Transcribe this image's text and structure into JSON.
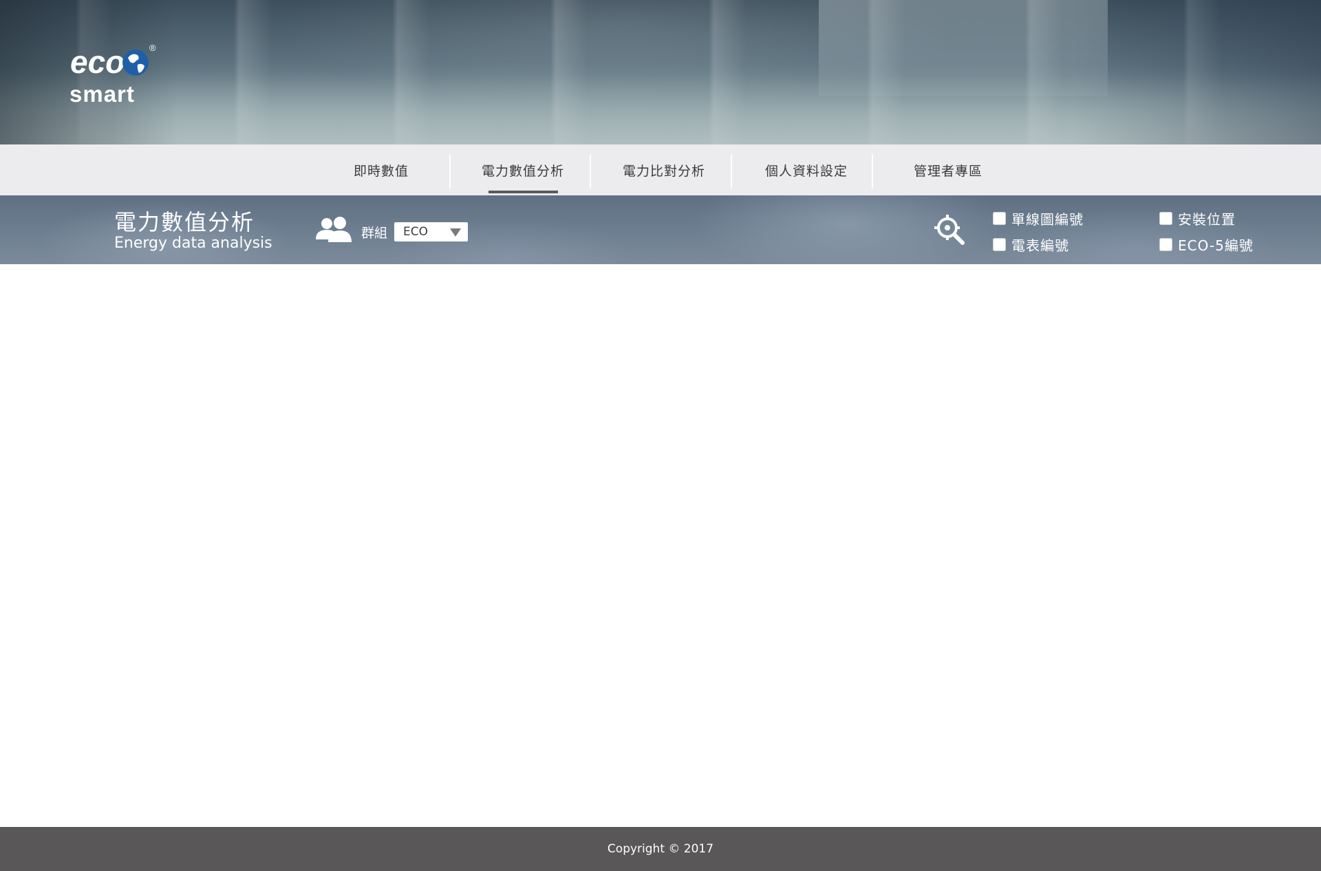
{
  "brand": {
    "logo_text_top": "eco",
    "logo_text_bottom": "smart",
    "registered_mark": "®"
  },
  "nav": {
    "items": [
      {
        "label": "即時數值",
        "active": false
      },
      {
        "label": "電力數值分析",
        "active": true
      },
      {
        "label": "電力比對分析",
        "active": false
      },
      {
        "label": "個人資料設定",
        "active": false
      },
      {
        "label": "管理者專區",
        "active": false
      }
    ]
  },
  "toolbar": {
    "title_zh": "電力數值分析",
    "title_en": "Energy data analysis",
    "group_label": "群組",
    "group_value": "ECO",
    "checkboxes": [
      {
        "label": "單線圖編號",
        "checked": false
      },
      {
        "label": "電表編號",
        "checked": false
      },
      {
        "label": "安裝位置",
        "checked": false
      },
      {
        "label": "ECO-5編號",
        "checked": false
      }
    ]
  },
  "footer": {
    "copyright": "Copyright © 2017"
  },
  "colors": {
    "nav_bg": "#ececee",
    "footer_bg": "#595758",
    "accent_underline": "#5a5a5a"
  },
  "icons": {
    "users": "users-icon",
    "locate": "locate-search-icon",
    "dropdown": "triangle-down-icon"
  }
}
